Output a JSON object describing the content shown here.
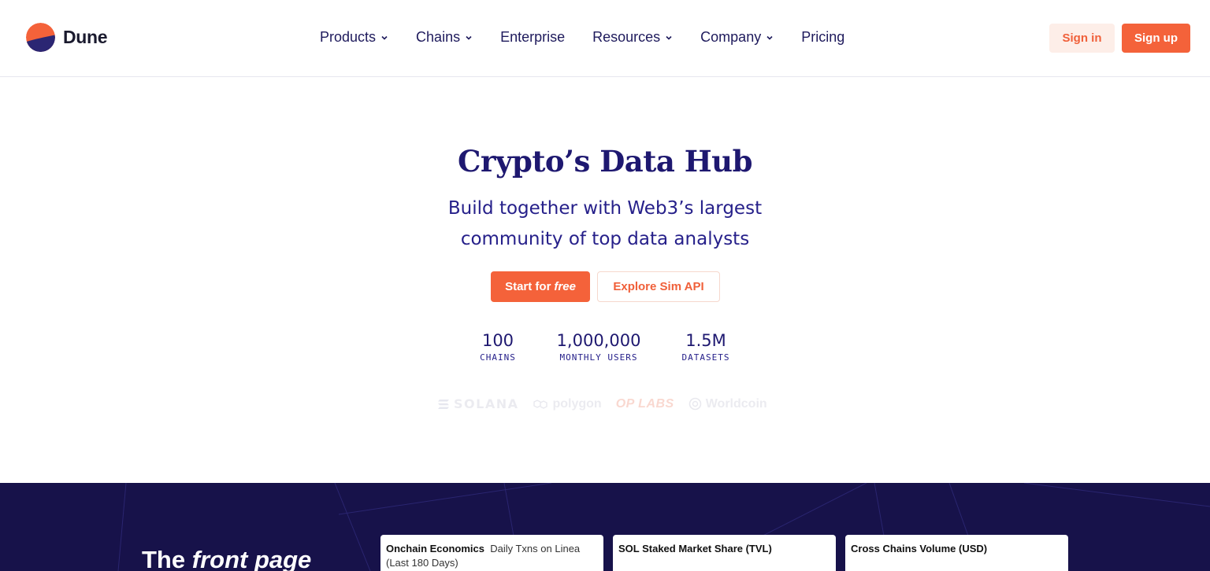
{
  "brand": {
    "name": "Dune",
    "colors": {
      "accent": "#f4623a",
      "navy": "#1e1870",
      "dark_section": "#17124a"
    }
  },
  "nav": {
    "items": [
      {
        "label": "Products",
        "has_dropdown": true
      },
      {
        "label": "Chains",
        "has_dropdown": true
      },
      {
        "label": "Enterprise",
        "has_dropdown": false
      },
      {
        "label": "Resources",
        "has_dropdown": true
      },
      {
        "label": "Company",
        "has_dropdown": true
      },
      {
        "label": "Pricing",
        "has_dropdown": false
      }
    ],
    "sign_in": "Sign in",
    "sign_up": "Sign up"
  },
  "hero": {
    "title": "Crypto’s Data Hub",
    "subtitle_line1": "Build together with Web3’s largest",
    "subtitle_line2": "community of top data analysts",
    "cta_primary_prefix": "Start for",
    "cta_primary_emphasis": "free",
    "cta_secondary": "Explore Sim API"
  },
  "stats": [
    {
      "value": "100",
      "label": "CHAINS"
    },
    {
      "value": "1,000,000",
      "label": "MONTHLY USERS"
    },
    {
      "value": "1.5M",
      "label": "DATASETS"
    }
  ],
  "partner_logos": [
    {
      "name": "SOLANA",
      "icon": "solana-icon"
    },
    {
      "name": "polygon",
      "icon": "polygon-icon"
    },
    {
      "name": "OP LABS",
      "icon": ""
    },
    {
      "name": "Worldcoin",
      "icon": "worldcoin-icon"
    }
  ],
  "showcase": {
    "heading_prefix": "The",
    "heading_emphasis": "front page",
    "cards": [
      {
        "title": "Onchain Economics",
        "subtitle": "Daily Txns on Linea (Last 180 Days)"
      },
      {
        "title": "SOL Staked Market Share (TVL)",
        "subtitle": ""
      },
      {
        "title": "Cross Chains Volume (USD)",
        "subtitle": ""
      }
    ]
  }
}
